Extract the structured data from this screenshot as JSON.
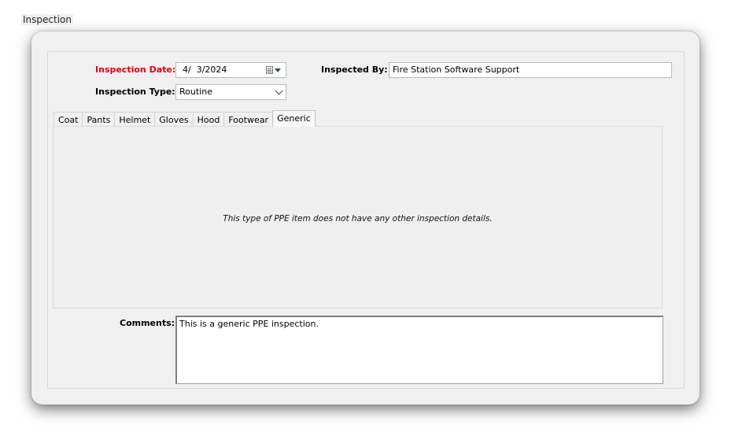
{
  "group": {
    "title": "Inspection"
  },
  "form": {
    "inspection_date_label": "Inspection Date:",
    "inspection_date_value": "4/  3/2024",
    "inspected_by_label": "Inspected By:",
    "inspected_by_value": "Fire Station Software Support",
    "inspection_type_label": "Inspection Type:",
    "inspection_type_value": "Routine"
  },
  "tabs": [
    {
      "label": "Coat"
    },
    {
      "label": "Pants"
    },
    {
      "label": "Helmet"
    },
    {
      "label": "Gloves"
    },
    {
      "label": "Hood"
    },
    {
      "label": "Footwear"
    },
    {
      "label": "Generic",
      "active": true
    }
  ],
  "panel": {
    "message": "This type of PPE item does not have any other inspection details."
  },
  "comments": {
    "label": "Comments:",
    "value": "This is a generic PPE inspection."
  },
  "colors": {
    "required_label": "#e0001a",
    "background": "#f0f0f0"
  }
}
